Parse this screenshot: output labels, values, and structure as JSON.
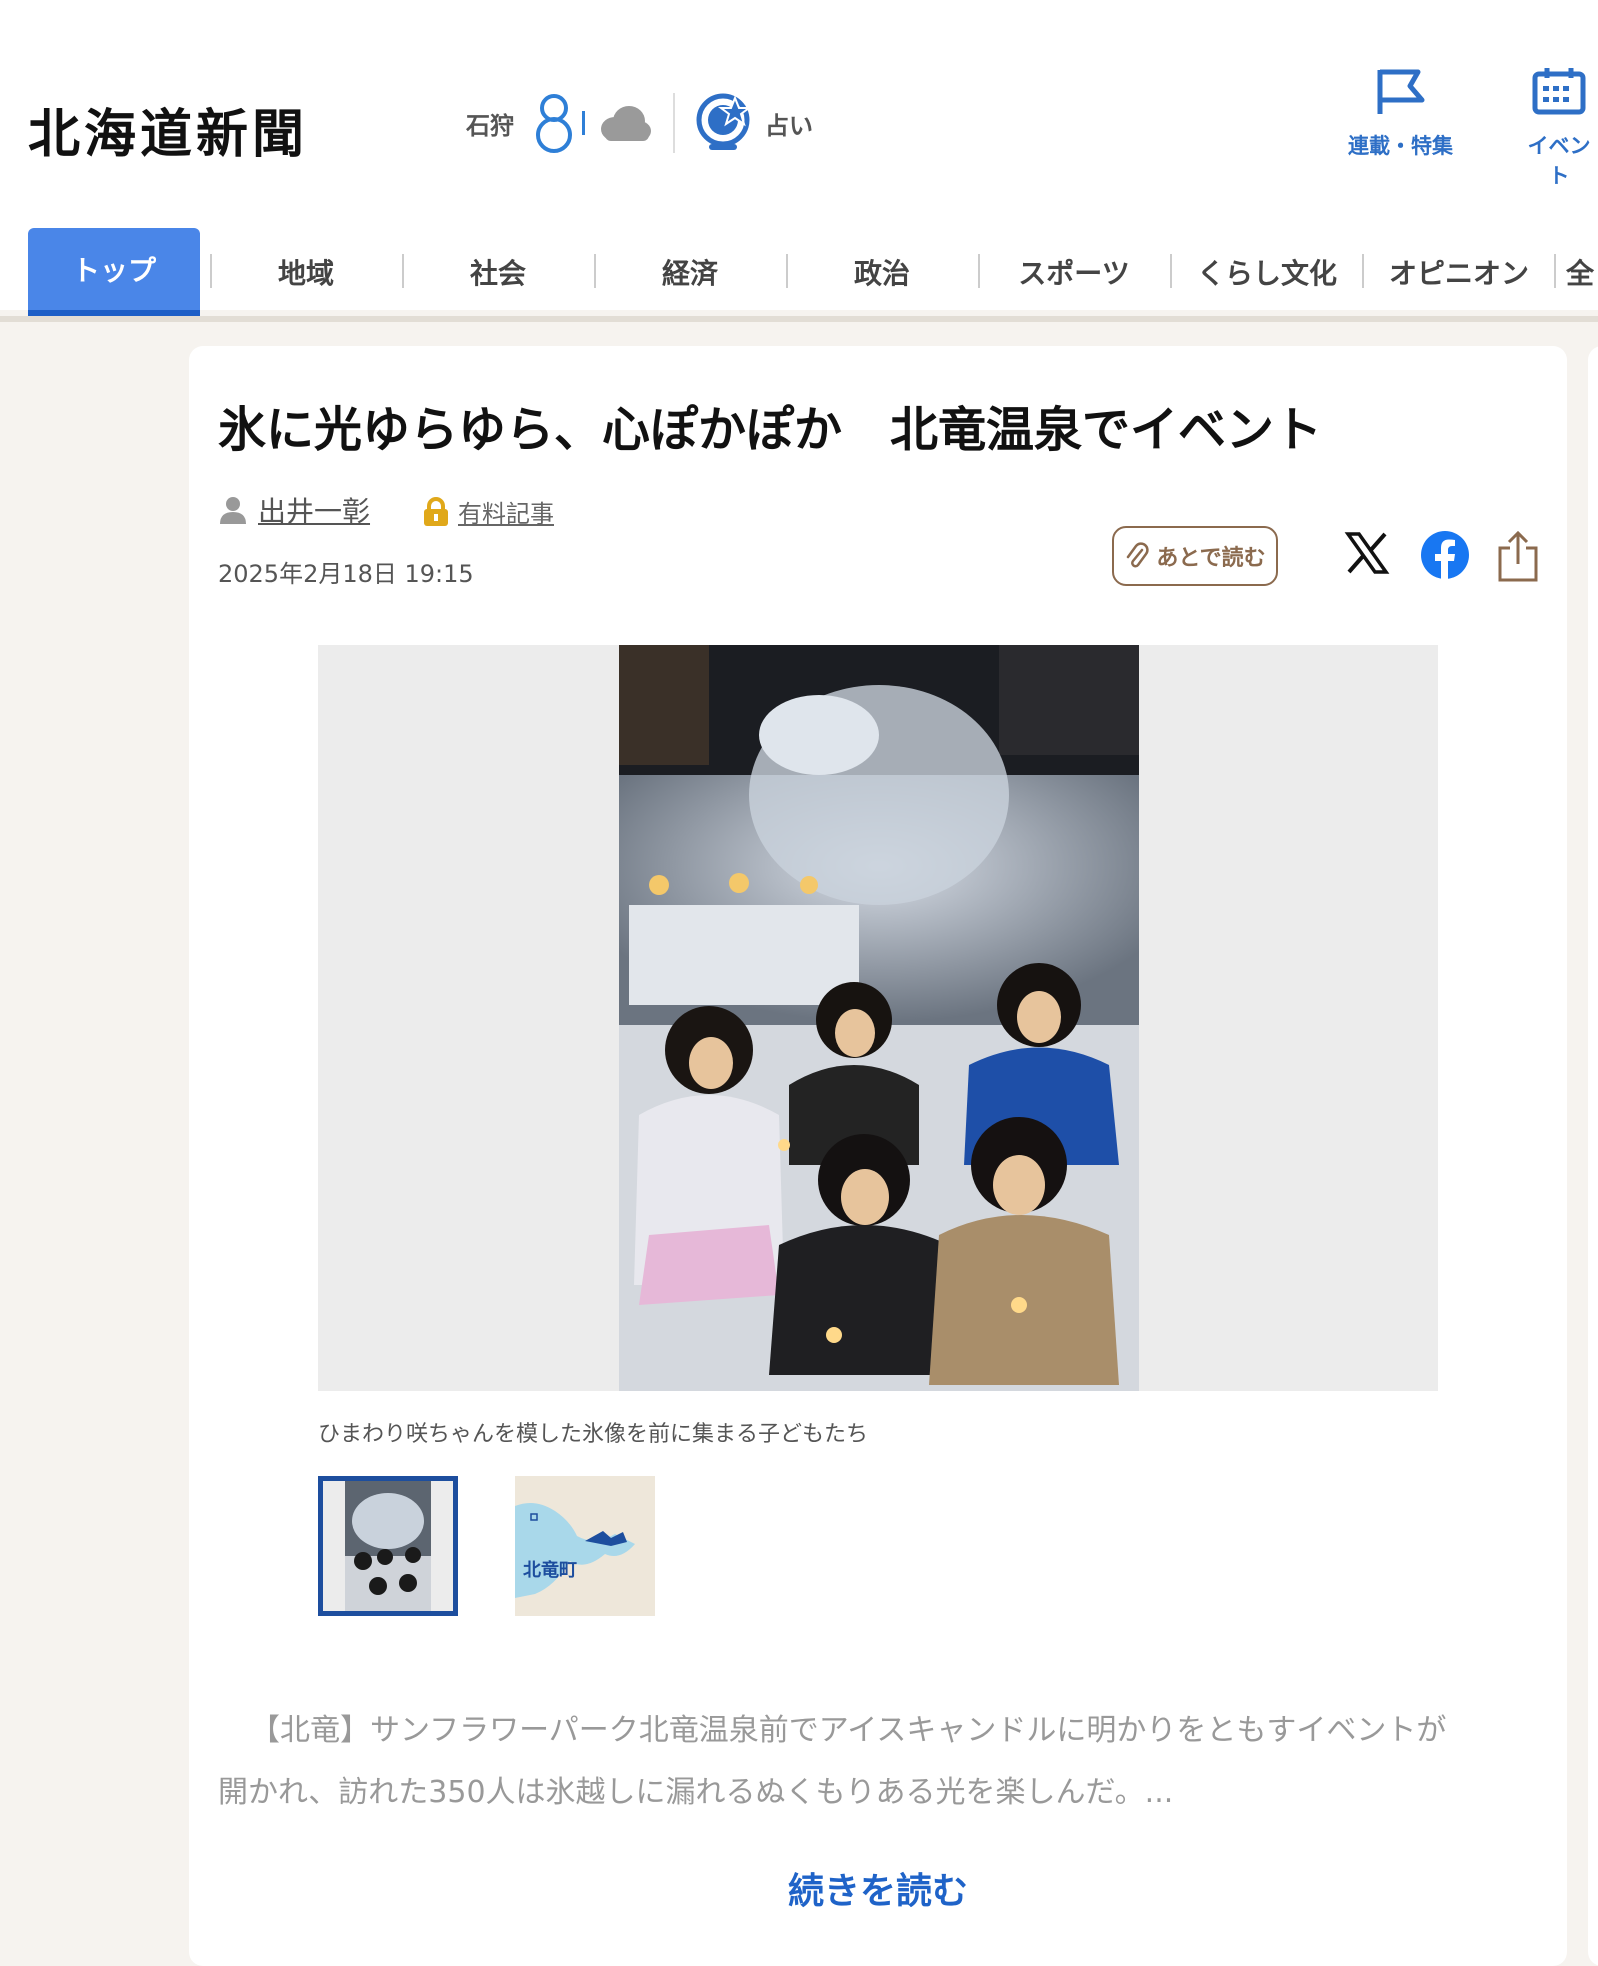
{
  "header": {
    "logo": "北海道新聞",
    "weather_location": "石狩",
    "fortune_label": "占い",
    "nav": [
      {
        "label": "連載・特集"
      },
      {
        "label": "イベント"
      }
    ]
  },
  "tabs": [
    "トップ",
    "地域",
    "社会",
    "経済",
    "政治",
    "スポーツ",
    "くらし文化",
    "オピニオン",
    "全"
  ],
  "article": {
    "title": "氷に光ゆらゆら、心ぽかぽか　北竜温泉でイベント",
    "author": "出井一彰",
    "paid_label": "有料記事",
    "date": "2025年2月18日 19:15",
    "read_later": "あとで読む",
    "photo_caption": "ひまわり咲ちゃんを模した氷像を前に集まる子どもたち",
    "map_label": "北竜町",
    "body_line1": "【北竜】サンフラワーパーク北竜温泉前でアイスキャンドルに明かりをともすイベントが",
    "body_line2": "開かれ、訪れた350人は氷越しに漏れるぬくもりある光を楽しんだ。...",
    "read_more": "続きを読む"
  },
  "colors": {
    "accent": "#4a86e8",
    "link": "#1f63c8",
    "active_thumb_border": "#1d4e9e",
    "later_button": "#8b6a4e"
  },
  "icons": [
    "snowman-icon",
    "cloud-icon",
    "fortune-icon",
    "flag-icon",
    "calendar-icon",
    "person-icon",
    "lock-icon",
    "paperclip-icon",
    "x-icon",
    "facebook-icon",
    "share-icon"
  ]
}
